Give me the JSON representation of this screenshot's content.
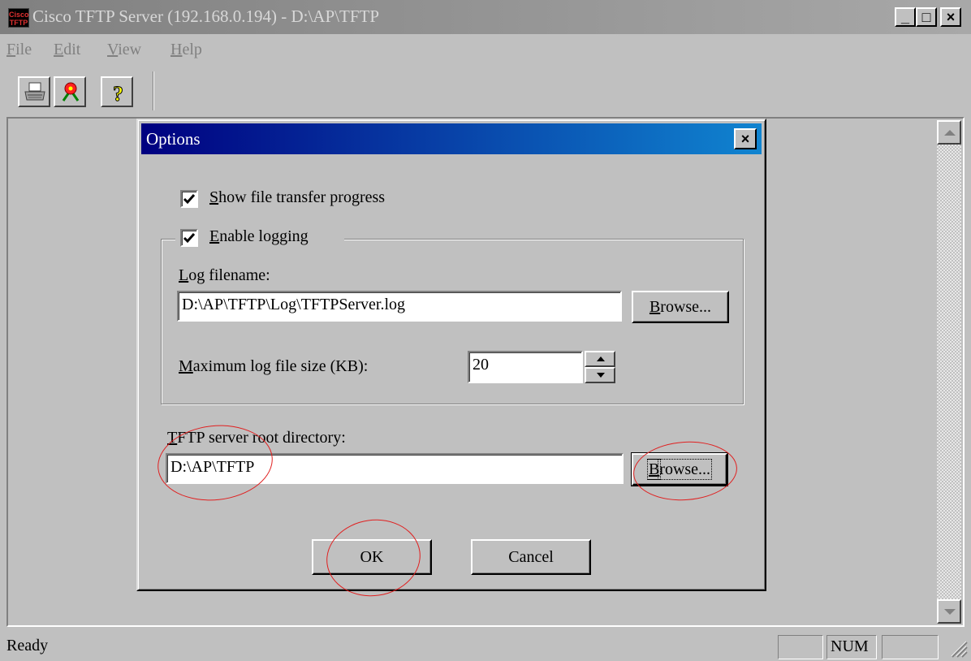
{
  "window": {
    "title": "Cisco TFTP Server (192.168.0.194) - D:\\AP\\TFTP",
    "app_icon_text": "Cisco TFTP",
    "minimize": "_",
    "maximize": "□",
    "close": "×"
  },
  "menu": {
    "file_key": "F",
    "file_rest": "ile",
    "edit_key": "E",
    "edit_rest": "dit",
    "view_key": "V",
    "view_rest": "iew",
    "help_key": "H",
    "help_rest": "elp"
  },
  "toolbar": {
    "icons": [
      "print-icon",
      "options-icon",
      "help-icon"
    ],
    "help_glyph": "?"
  },
  "dialog": {
    "title": "Options",
    "close": "×",
    "show_progress": {
      "key": "S",
      "rest": "how file transfer progress",
      "checked": true
    },
    "enable_logging": {
      "key": "E",
      "rest": "nable logging",
      "checked": true
    },
    "log_filename_label": {
      "key": "L",
      "rest": "og filename:"
    },
    "log_filename_value": "D:\\AP\\TFTP\\Log\\TFTPServer.log",
    "browse_log": {
      "key": "B",
      "rest": "rowse..."
    },
    "max_log_label": {
      "key": "M",
      "rest": "aximum log file size (KB):"
    },
    "max_log_value": "20",
    "root_dir_label": {
      "key": "T",
      "rest": "FTP server root directory:"
    },
    "root_dir_value": "D:\\AP\\TFTP",
    "browse_root": {
      "key": "B",
      "rest": "rowse..."
    },
    "ok": "OK",
    "cancel": "Cancel"
  },
  "status": {
    "text": "Ready",
    "num": "NUM"
  },
  "colors": {
    "dialog_title": "#000080",
    "face": "#c0c0c0",
    "annotation": "#e02020"
  }
}
